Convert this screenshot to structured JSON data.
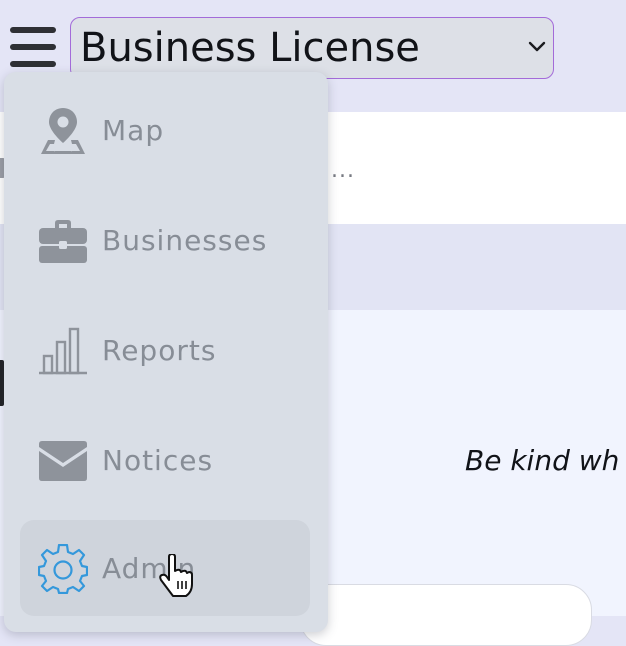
{
  "header": {
    "app_select_value": "Business License"
  },
  "background": {
    "ellipsis_text": "....",
    "motto_text": "Be kind wh"
  },
  "menu": {
    "items": [
      {
        "label": "Map",
        "icon": "map-pin-icon"
      },
      {
        "label": "Businesses",
        "icon": "briefcase-icon"
      },
      {
        "label": "Reports",
        "icon": "bar-chart-icon"
      },
      {
        "label": "Notices",
        "icon": "envelope-icon"
      },
      {
        "label": "Admin",
        "icon": "gear-icon",
        "active": true
      }
    ]
  },
  "colors": {
    "topbar_bg": "#e4e5f6",
    "menu_bg": "#d9dee6",
    "icon_gray": "#8e939b",
    "icon_active": "#3498db",
    "select_border": "#a36bd9"
  }
}
